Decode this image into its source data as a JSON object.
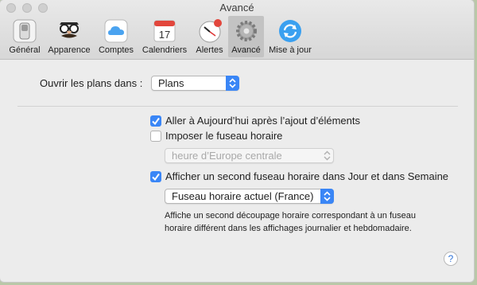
{
  "window": {
    "title": "Avancé"
  },
  "toolbar": {
    "items": [
      {
        "label": "Général"
      },
      {
        "label": "Apparence"
      },
      {
        "label": "Comptes"
      },
      {
        "label": "Calendriers",
        "date": "17"
      },
      {
        "label": "Alertes"
      },
      {
        "label": "Avancé",
        "selected": true
      },
      {
        "label": "Mise à jour"
      }
    ]
  },
  "form": {
    "open_plans_label": "Ouvrir les plans dans :",
    "open_plans_value": "Plans",
    "goto_today": {
      "label": "Aller à Aujourd’hui après l’ajout d’éléments",
      "checked": true
    },
    "force_timezone": {
      "label": "Imposer le fuseau horaire",
      "checked": false
    },
    "timezone_value": "heure d’Europe centrale",
    "second_timezone": {
      "label": "Afficher un second fuseau horaire dans Jour et dans Semaine",
      "checked": true
    },
    "second_timezone_value": "Fuseau horaire actuel (France)",
    "description_line1": "Affiche un second découpage horaire correspondant à un fuseau",
    "description_line2": "horaire différent dans les affichages journalier et hebdomadaire.",
    "help_label": "?"
  },
  "colors": {
    "accent": "#3a86f6",
    "window_bg": "#ececec"
  }
}
